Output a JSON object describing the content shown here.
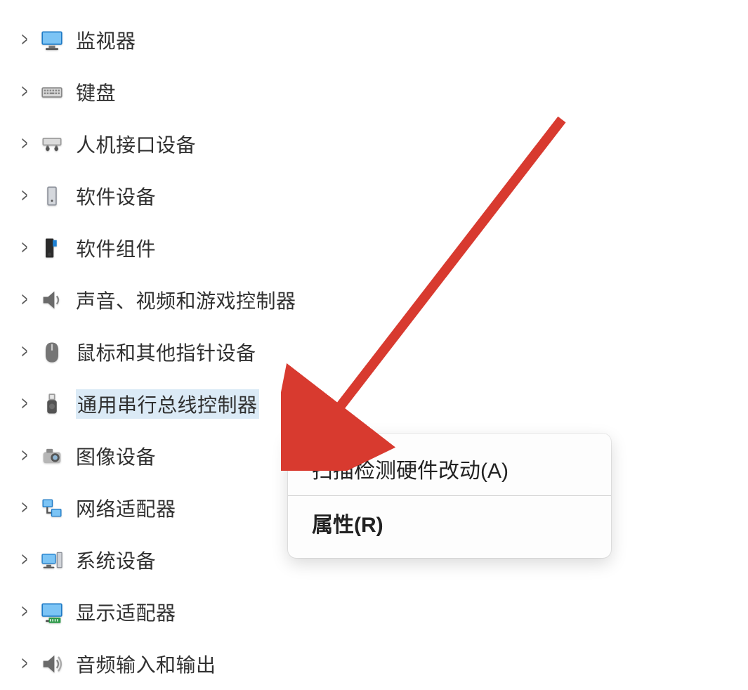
{
  "tree": [
    {
      "key": "monitors",
      "label": "监视器",
      "icon": "monitor"
    },
    {
      "key": "keyboards",
      "label": "键盘",
      "icon": "keyboard"
    },
    {
      "key": "hid",
      "label": "人机接口设备",
      "icon": "hid"
    },
    {
      "key": "softdev",
      "label": "软件设备",
      "icon": "softdev"
    },
    {
      "key": "softcomp",
      "label": "软件组件",
      "icon": "softcomp"
    },
    {
      "key": "sound",
      "label": "声音、视频和游戏控制器",
      "icon": "speaker"
    },
    {
      "key": "mouse",
      "label": "鼠标和其他指针设备",
      "icon": "mouse"
    },
    {
      "key": "usb",
      "label": "通用串行总线控制器",
      "icon": "usb",
      "selected": true,
      "clipped": true
    },
    {
      "key": "imaging",
      "label": "图像设备",
      "icon": "camera"
    },
    {
      "key": "network",
      "label": "网络适配器",
      "icon": "network"
    },
    {
      "key": "system",
      "label": "系统设备",
      "icon": "system"
    },
    {
      "key": "display",
      "label": "显示适配器",
      "icon": "display"
    },
    {
      "key": "audioio",
      "label": "音频输入和输出",
      "icon": "speakerio"
    }
  ],
  "context_menu": {
    "scan": "扫描检测硬件改动(A)",
    "props": "属性(R)"
  },
  "colors": {
    "highlight": "#dbeaf6",
    "arrow": "#d83a2f"
  }
}
